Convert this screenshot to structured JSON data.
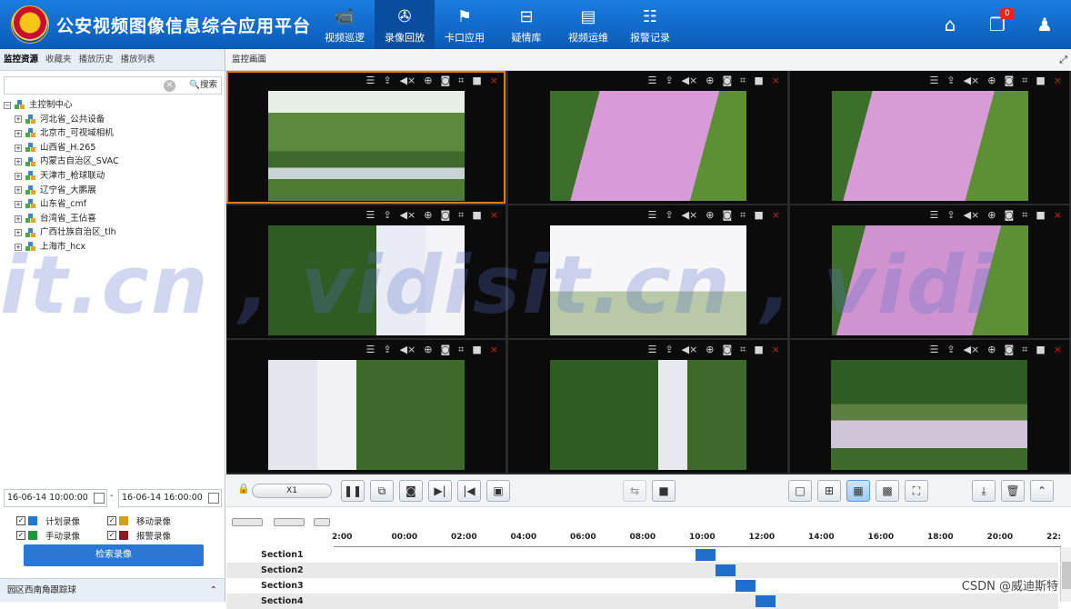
{
  "header": {
    "title": "公安视频图像信息综合应用平台",
    "nav": [
      {
        "label": "视频巡逻",
        "icon": "camera-icon",
        "glyph": "⌐"
      },
      {
        "label": "录像回放",
        "icon": "film-reel-icon",
        "glyph": "✇",
        "active": true
      },
      {
        "label": "卡口应用",
        "icon": "checkpoint-icon",
        "glyph": "⛳"
      },
      {
        "label": "疑情库",
        "icon": "database-icon",
        "glyph": "⊟"
      },
      {
        "label": "视频运维",
        "icon": "id-card-icon",
        "glyph": "▤"
      },
      {
        "label": "报警记录",
        "icon": "clipboard-icon",
        "glyph": "📋"
      }
    ],
    "notification_count": "0"
  },
  "left": {
    "tabs": [
      "监控资源",
      "收藏夹",
      "播放历史",
      "播放列表"
    ],
    "search_button": "搜索",
    "tree_root": "主控制中心",
    "tree_items": [
      "河北省_公共设备",
      "北京市_可视域相机",
      "山西省_H.265",
      "内蒙古自治区_SVAC",
      "天津市_枪球联动",
      "辽宁省_大鹏展",
      "山东省_cmf",
      "台湾省_王佔喜",
      "广西壮族自治区_tlh",
      "上海市_hcx"
    ],
    "start_time": "16-06-14 10:00:00",
    "end_time": "16-06-14 16:00:00",
    "range_separator": "-",
    "legend": [
      {
        "label": "计划录像",
        "color": "#1f7ad6"
      },
      {
        "label": "移动录像",
        "color": "#d4a017"
      },
      {
        "label": "手动录像",
        "color": "#1c9a3a"
      },
      {
        "label": "报警录像",
        "color": "#8b1a1a"
      }
    ],
    "search_record_button": "检索录像",
    "bottom_panel": "园区西南角跟踪球"
  },
  "main": {
    "title": "监控画面",
    "speed": "X1"
  },
  "timeline": {
    "ticks": [
      "2:00",
      "00:00",
      "02:00",
      "04:00",
      "06:00",
      "08:00",
      "10:00",
      "12:00",
      "14:00",
      "16:00",
      "18:00",
      "20:00",
      "22:"
    ],
    "sections": [
      "Section1",
      "Section2",
      "Section3",
      "Section4"
    ]
  },
  "watermark": "it.cn , vidisit.cn , vidi",
  "credit": "CSDN @威迪斯特"
}
